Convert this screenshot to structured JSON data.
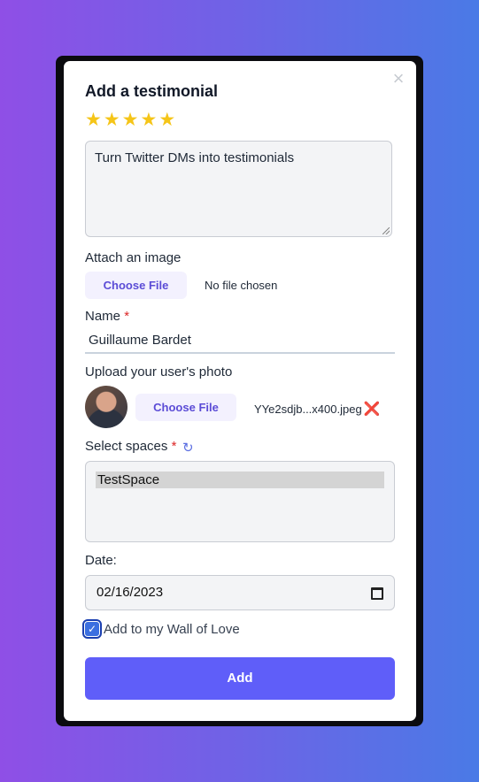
{
  "modal": {
    "title": "Add a testimonial",
    "rating": 5,
    "stars": [
      "★",
      "★",
      "★",
      "★",
      "★"
    ],
    "testimonial_text": "Turn Twitter DMs into testimonials",
    "attach_image": {
      "label": "Attach an image",
      "button_label": "Choose File",
      "status": "No file chosen"
    },
    "name": {
      "label": "Name",
      "required_mark": "*",
      "value": "Guillaume Bardet"
    },
    "photo": {
      "label": "Upload your user's photo",
      "button_label": "Choose File",
      "filename": "YYe2sdjb...x400.jpeg",
      "remove_glyph": "❌"
    },
    "spaces": {
      "label": "Select spaces",
      "required_mark": "*",
      "options": [
        "TestSpace"
      ]
    },
    "date": {
      "label": "Date:",
      "value": "02/16/2023"
    },
    "wall_of_love": {
      "checked": true,
      "label": "Add to my Wall of Love"
    },
    "submit_label": "Add",
    "close_glyph": "×"
  },
  "colors": {
    "accent": "#5f5ef9",
    "star": "#f5c518",
    "required": "#dc2626",
    "file_button_text": "#5b4cd6"
  }
}
